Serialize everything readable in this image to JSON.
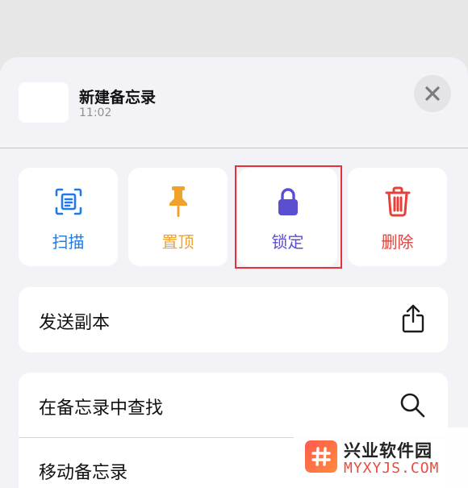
{
  "note": {
    "title": "新建备忘录",
    "time": "11:02"
  },
  "close_icon": "xmark-icon",
  "actions": [
    {
      "label": "扫描",
      "icon": "scan-document-icon",
      "color": "#1f7ae8"
    },
    {
      "label": "置顶",
      "icon": "pin-icon",
      "color": "#f2a22a"
    },
    {
      "label": "锁定",
      "icon": "lock-icon",
      "color": "#5a4fcf",
      "highlighted": true
    },
    {
      "label": "删除",
      "icon": "trash-icon",
      "color": "#e6403a"
    }
  ],
  "rows": {
    "send_copy": {
      "label": "发送副本",
      "icon": "share-icon"
    },
    "find_in_note": {
      "label": "在备忘录中查找",
      "icon": "magnifying-glass-icon"
    },
    "move_note": {
      "label": "移动备忘录"
    }
  },
  "watermark": {
    "name": "兴业软件园",
    "url": "MYXYJS.COM",
    "logo": "hash-logo"
  },
  "colors": {
    "highlight_border": "#e8303a",
    "sheet_background": "#f2f2f7",
    "backdrop": "#e7e7e7"
  }
}
